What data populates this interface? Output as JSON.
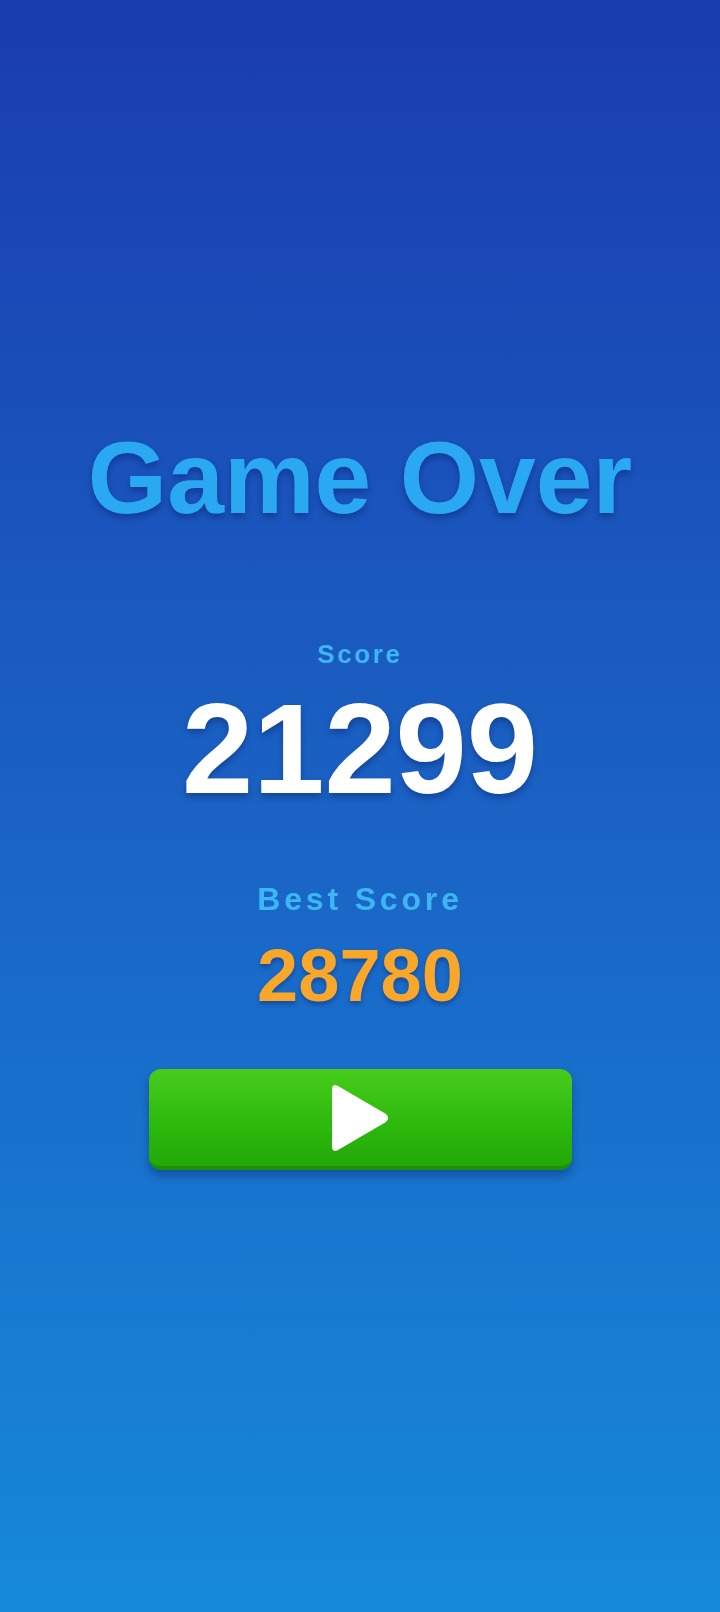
{
  "title": "Game Over",
  "score": {
    "label": "Score",
    "value": "21299"
  },
  "best_score": {
    "label": "Best Score",
    "value": "28780"
  }
}
